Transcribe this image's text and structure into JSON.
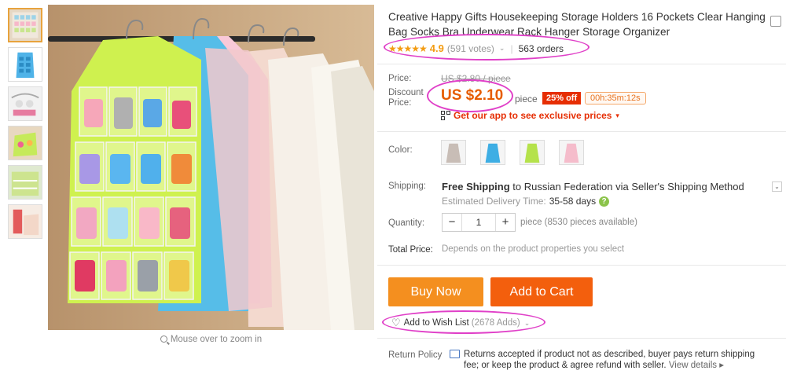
{
  "product": {
    "title": "Creative Happy Gifts Housekeeping Storage Holders 16 Pockets Clear Hanging Bag Socks Bra Underwear Rack Hanger Storage Organizer",
    "stars": "★★★★★",
    "rating": "4.9",
    "votes": "(591 votes)",
    "orders": "563 orders"
  },
  "gallery": {
    "thumbnails": [
      "thumb-1",
      "thumb-2",
      "thumb-3",
      "thumb-4",
      "thumb-5",
      "thumb-6"
    ],
    "zoom_hint": "Mouse over to zoom in"
  },
  "pricing": {
    "price_label": "Price:",
    "original_price": "US $2.80 / piece",
    "discount_label": "Discount Price:",
    "discount_price": "US $2.10",
    "unit": "piece",
    "discount_badge": "25% off",
    "timer": "00h:35m:12s",
    "app_promo": "Get our app to see exclusive prices"
  },
  "color": {
    "label": "Color:",
    "options": [
      "gray",
      "blue",
      "green",
      "pink"
    ]
  },
  "shipping": {
    "label": "Shipping:",
    "free_text": "Free Shipping",
    "to_text": "to Russian Federation via Seller's Shipping Method",
    "estimated_label": "Estimated Delivery Time:",
    "estimated_days": "35-58 days",
    "help": "?"
  },
  "quantity": {
    "label": "Quantity:",
    "minus": "−",
    "value": "1",
    "plus": "+",
    "available": "piece (8530 pieces available)"
  },
  "total": {
    "label": "Total Price:",
    "value": "Depends on the product properties you select"
  },
  "actions": {
    "buy_now": "Buy Now",
    "add_to_cart": "Add to Cart",
    "wishlist": "Add to Wish List",
    "wishlist_count": "(2678 Adds)"
  },
  "return_policy": {
    "label": "Return Policy",
    "text": "Returns accepted if product not as described, buyer pays return shipping fee; or keep the product & agree refund with seller.",
    "more": "View details ▸"
  },
  "colors": {
    "accent_orange": "#f48f1f",
    "cart_orange": "#f35f0d",
    "price_orange": "#e65c00",
    "badge_red": "#e62e04",
    "annotation_pink": "#e040c8"
  }
}
